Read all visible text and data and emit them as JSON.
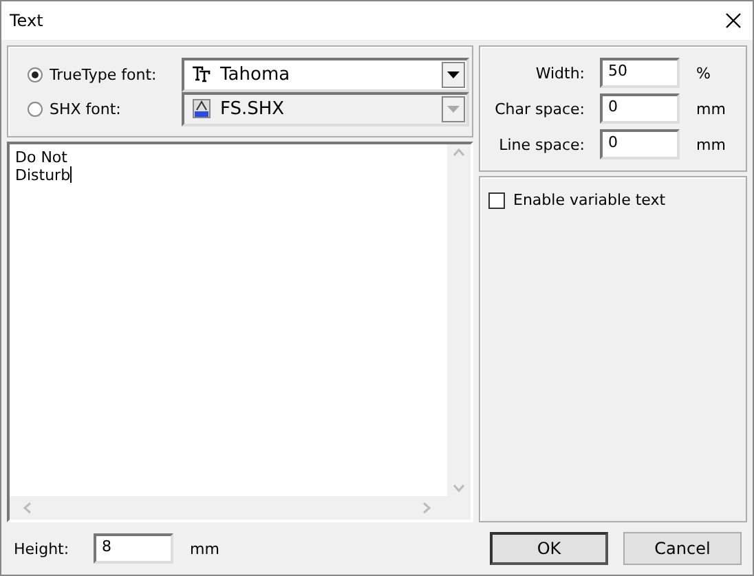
{
  "window": {
    "title": "Text"
  },
  "font_options": [
    {
      "kind": "truetype",
      "label": "TrueType font:",
      "selected": true,
      "font": "Tahoma",
      "disabled": false
    },
    {
      "kind": "shx",
      "label": "SHX font:",
      "selected": false,
      "font": "FS.SHX",
      "disabled": true
    }
  ],
  "text": {
    "value": "Do Not\nDisturb"
  },
  "spacing": [
    {
      "label": "Width:",
      "value": "50",
      "unit": "%"
    },
    {
      "label": "Char space:",
      "value": "0",
      "unit": "mm"
    },
    {
      "label": "Line space:",
      "value": "0",
      "unit": "mm"
    }
  ],
  "variable_text": {
    "label": "Enable variable text",
    "checked": false
  },
  "height": {
    "label": "Height:",
    "value": "8",
    "unit": "mm"
  },
  "buttons": [
    {
      "label": "OK",
      "default": true
    },
    {
      "label": "Cancel",
      "default": false
    }
  ]
}
